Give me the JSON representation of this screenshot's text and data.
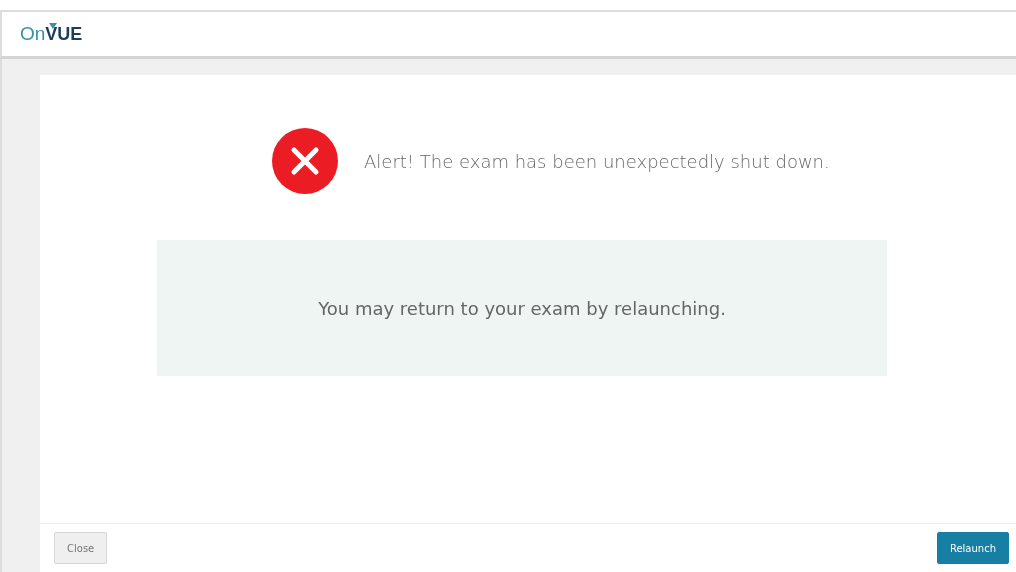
{
  "header": {
    "logo_prefix": "On",
    "logo_name": "VUE"
  },
  "alert": {
    "message": "Alert! The exam has been unexpectedly shut down."
  },
  "info": {
    "message": "You may return to your exam by relaunching."
  },
  "footer": {
    "buttons": [
      {
        "label": "Close",
        "kind": "secondary"
      },
      {
        "label": "Relaunch",
        "kind": "primary"
      }
    ]
  }
}
